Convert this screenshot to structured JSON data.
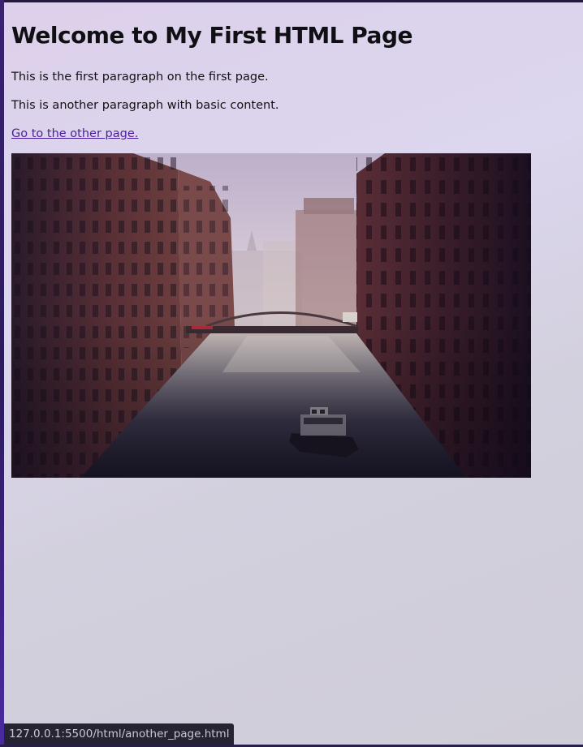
{
  "page": {
    "heading": "Welcome to My First HTML Page",
    "paragraphs": [
      "This is the first paragraph on the first page.",
      "This is another paragraph with basic content."
    ],
    "link_text": "Go to the other page.",
    "image_alt": ""
  },
  "status_bar": {
    "url": "127.0.0.1:5500/html/another_page.html"
  },
  "colors": {
    "link": "#4d1f9a",
    "heading": "#0f0f14",
    "status_bg": "#262433",
    "status_text": "#c9c7d6"
  }
}
